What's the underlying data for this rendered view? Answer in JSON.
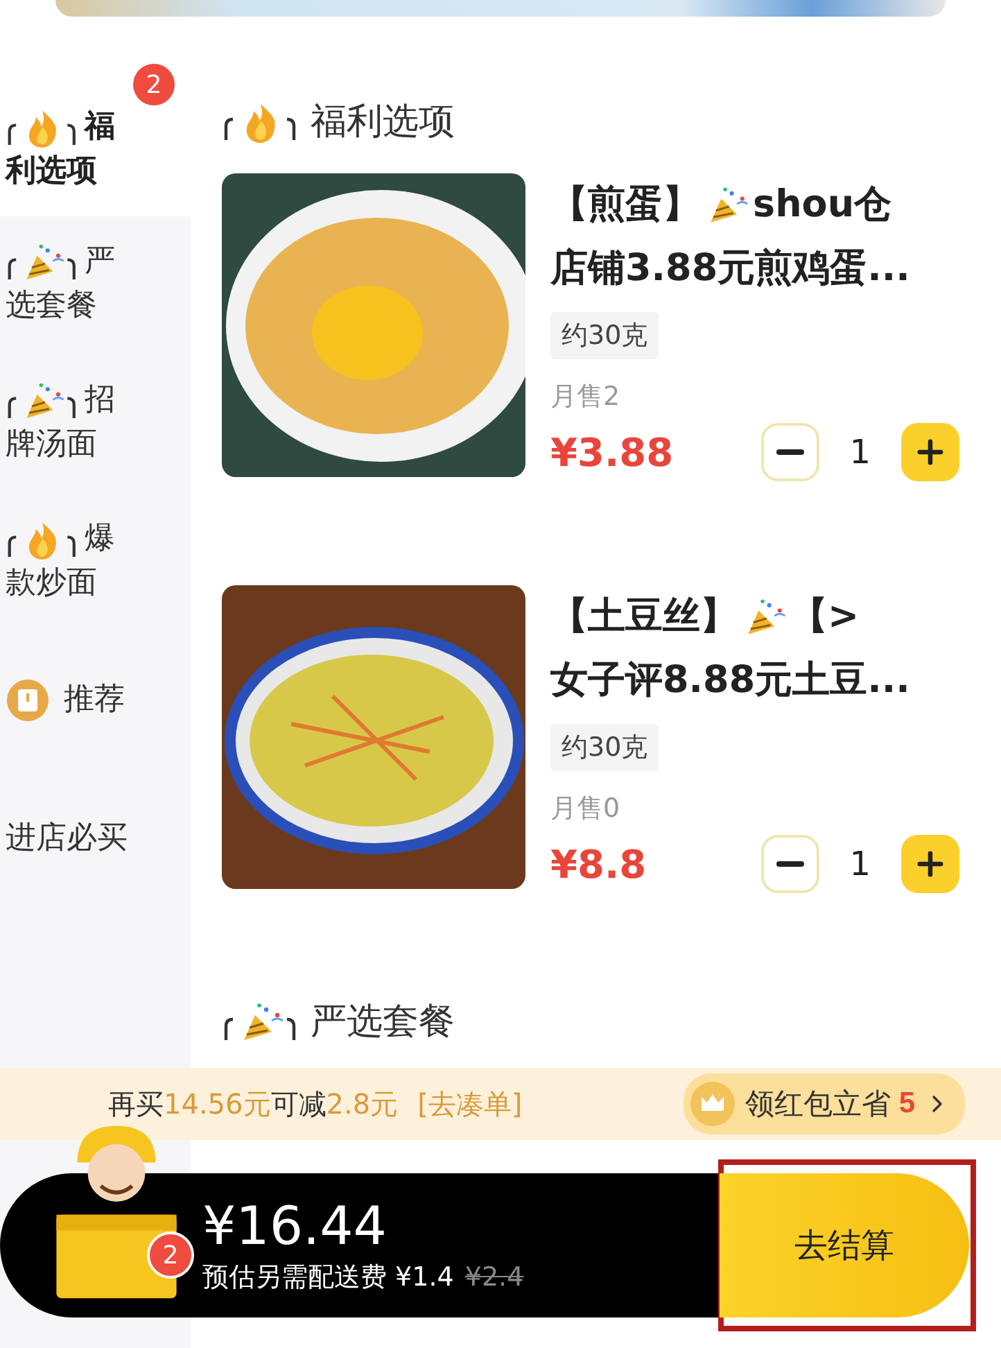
{
  "sidebar": {
    "items": [
      {
        "kind": "fire",
        "label_line1": "福",
        "label_line2": "利选项",
        "selected": true,
        "badge": "2"
      },
      {
        "kind": "party",
        "label_line1": "严",
        "label_line2": "选套餐",
        "selected": false
      },
      {
        "kind": "party",
        "label_line1": "招",
        "label_line2": "牌汤面",
        "selected": false
      },
      {
        "kind": "fire",
        "label_line1": "爆",
        "label_line2": "款炒面",
        "selected": false
      },
      {
        "kind": "book",
        "label_line1": "推荐",
        "selected": false
      },
      {
        "kind": "plain",
        "label_line1": "进店必买",
        "selected": false
      }
    ]
  },
  "sections": [
    {
      "kind": "fire",
      "title": "福利选项",
      "products": [
        {
          "name_lead": "【煎蛋】",
          "name_rest": "shou仓",
          "name_line2": "店铺3.88元煎鸡蛋...",
          "tag": "约30克",
          "sales": "月售2",
          "price": "¥3.88",
          "quantity": "1"
        },
        {
          "name_lead": "【土豆丝】",
          "name_rest": "【>",
          "name_line2": "女子评8.88元土豆...",
          "tag": "约30克",
          "sales": "月售0",
          "price": "¥8.8",
          "quantity": "1"
        }
      ]
    },
    {
      "kind": "party",
      "title": "严选套餐"
    }
  ],
  "promo": {
    "segments": [
      {
        "text": "再买",
        "accent": false
      },
      {
        "text": "14.56元",
        "accent": true
      },
      {
        "text": "可减",
        "accent": false
      },
      {
        "text": "2.8元",
        "accent": true
      },
      {
        "text": "[去凑单]",
        "accent": true
      }
    ],
    "coupon_label": "领红包立省",
    "coupon_amount": "5"
  },
  "cart": {
    "badge": "2",
    "total": "¥16.44",
    "fee": "预估另需配送费 ¥1.4",
    "fee_original": "¥2.4",
    "checkout": "去结算",
    "checkout_highlighted": true
  }
}
